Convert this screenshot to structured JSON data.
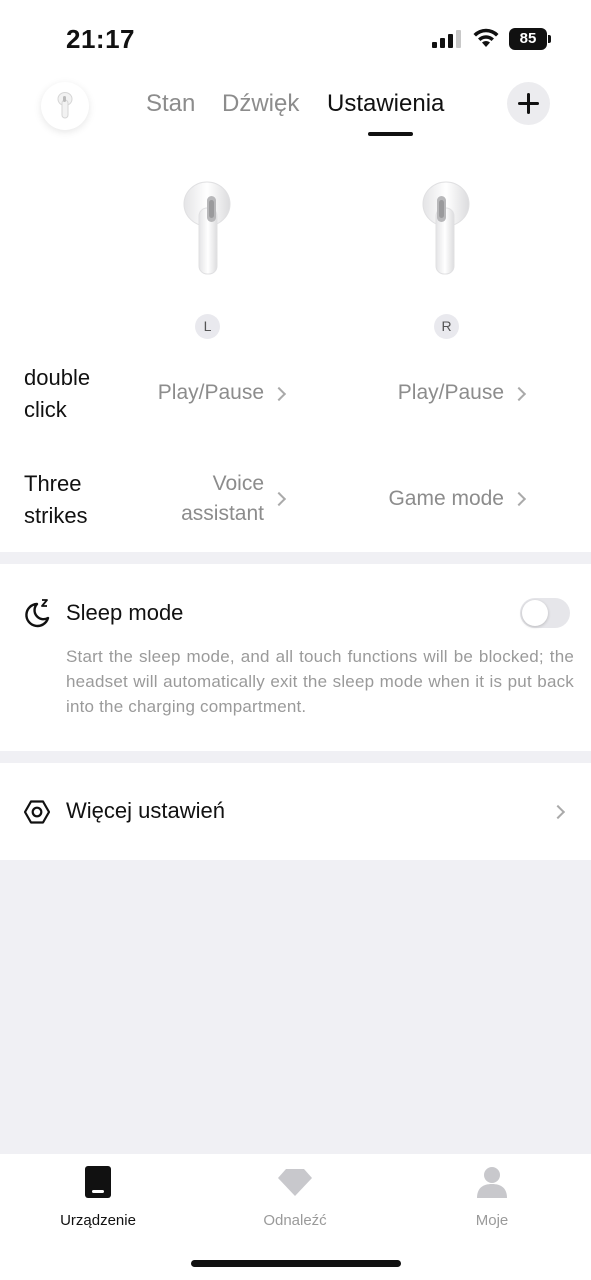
{
  "status_bar": {
    "time": "21:17",
    "battery": "85"
  },
  "header": {
    "tabs": [
      {
        "label": "Stan",
        "active": false
      },
      {
        "label": "Dźwięk",
        "active": false
      },
      {
        "label": "Ustawienia",
        "active": true
      }
    ],
    "add_icon": "plus-icon"
  },
  "earbuds": {
    "left_label": "L",
    "right_label": "R"
  },
  "gestures": [
    {
      "label": "double click",
      "left": "Play/Pause",
      "right": "Play/Pause"
    },
    {
      "label": "Three strikes",
      "left": "Voice assistant",
      "right": "Game mode"
    }
  ],
  "sleep": {
    "icon": "moon-icon",
    "title": "Sleep mode",
    "enabled": false,
    "description": "Start the sleep mode, and all touch functions will be blocked; the headset will automatically exit the sleep mode when it is put back into the charging compartment."
  },
  "more": {
    "icon": "hexagon-settings-icon",
    "label": "Więcej ustawień"
  },
  "tab_bar": [
    {
      "label": "Urządzenie",
      "icon": "device-icon",
      "active": true
    },
    {
      "label": "Odnaleźć",
      "icon": "diamond-icon",
      "active": false
    },
    {
      "label": "Moje",
      "icon": "person-icon",
      "active": false
    }
  ],
  "colors": {
    "active_text": "#111111",
    "inactive_text": "#8c8c8c",
    "section_bg": "#f0f0f4"
  }
}
